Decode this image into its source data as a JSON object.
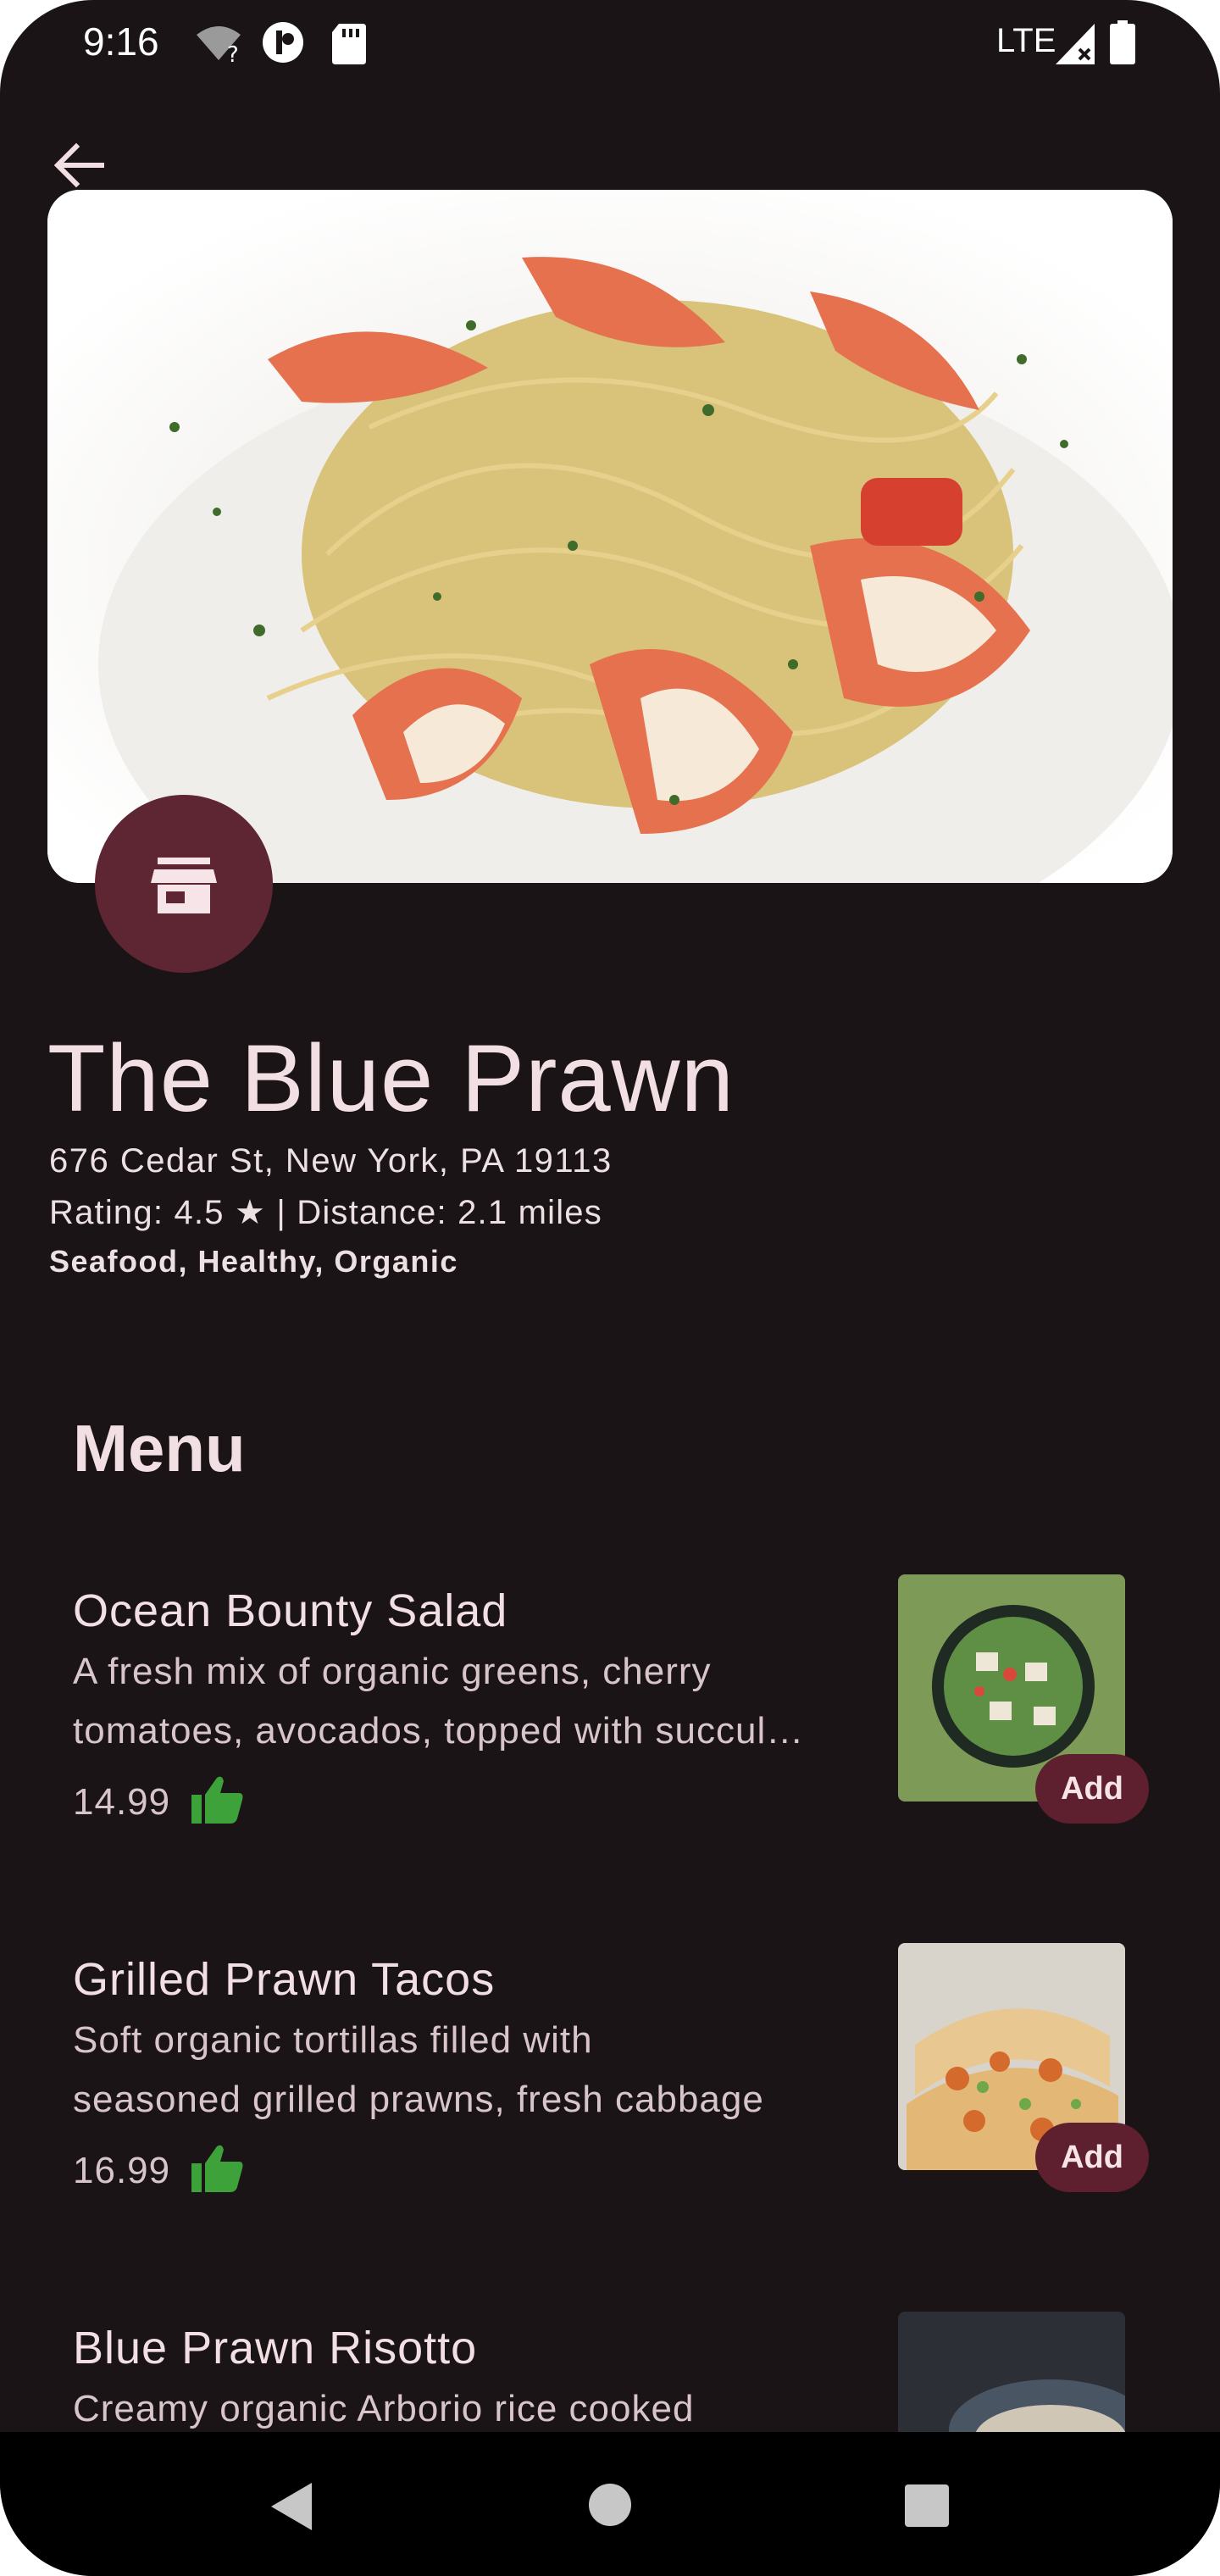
{
  "status_bar": {
    "time": "9:16",
    "network": "LTE"
  },
  "restaurant": {
    "name": "The Blue Prawn",
    "address": "676 Cedar St, New York, PA 19113",
    "rating_line": "Rating: 4.5 ★ | Distance: 2.1 miles",
    "tags": "Seafood, Healthy, Organic"
  },
  "menu": {
    "title": "Menu",
    "items": [
      {
        "name": "Ocean Bounty Salad",
        "desc_line1": "A fresh mix of organic greens, cherry",
        "desc_line2": "tomatoes, avocados, topped with succulent",
        "price": "14.99",
        "add_label": "Add"
      },
      {
        "name": "Grilled Prawn Tacos",
        "desc_line1": "Soft organic tortillas filled with",
        "desc_line2": "seasoned grilled prawns, fresh cabbage",
        "price": "16.99",
        "add_label": "Add"
      },
      {
        "name": "Blue Prawn Risotto",
        "desc_line1": "Creamy organic Arborio rice cooked",
        "desc_line2": "",
        "price": "",
        "add_label": ""
      }
    ]
  },
  "icons": {
    "back": "arrow-back-icon",
    "store": "storefront-icon",
    "thumb": "thumb-up-icon"
  },
  "colors": {
    "background": "#1b1416",
    "accent": "#5e1f2e",
    "thumb_green": "#3ea23a"
  }
}
